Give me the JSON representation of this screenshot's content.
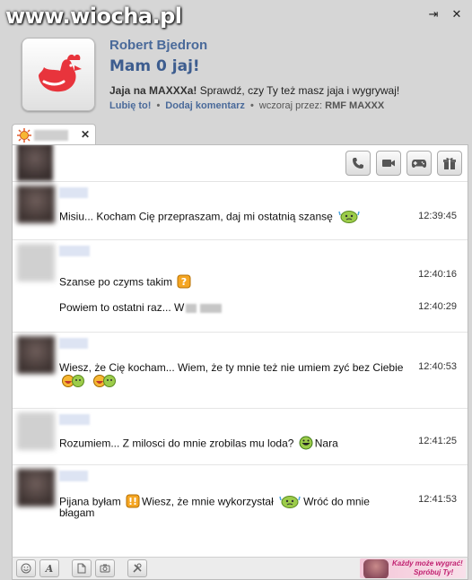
{
  "watermark": "www.wiocha.pl",
  "notification": {
    "name": "Robert Bjedron",
    "title": "Mam 0 jaj!",
    "desc_bold": "Jaja na MAXXXa!",
    "desc_rest": " Sprawdź, czy Ty też masz jaja i wygrywaj!",
    "like": "Lubię to!",
    "comment": "Dodaj komentarz",
    "via_label": "wczoraj przez: ",
    "via_value": "RMF MAXXX"
  },
  "tab": {
    "close": "✕"
  },
  "messages": [
    {
      "avatar": "dark",
      "lines": [
        {
          "parts": [
            "Misiu... Kocham Cię przepraszam, daj mi ostatnią szansę",
            {
              "emoticon": "sad-green"
            }
          ],
          "time": "12:39:45"
        }
      ]
    },
    {
      "avatar": "light",
      "lines": [
        {
          "parts": [
            "Szanse po czyms takim",
            {
              "emoticon": "question"
            }
          ],
          "time": "12:40:16"
        },
        {
          "parts": [
            "Powiem to ostatni raz... W",
            {
              "blur": 1
            },
            {
              "blur": 1
            }
          ],
          "time": "12:40:29"
        }
      ]
    },
    {
      "avatar": "dark",
      "lines": [
        {
          "parts": [
            "Wiesz, że Cię kocham... Wiem, że ty mnie też nie umiem zyć bez Ciebie",
            {
              "emoticon": "laugh-pair"
            },
            {
              "emoticon": "laugh-pair"
            }
          ],
          "time": "12:40:53"
        }
      ]
    },
    {
      "avatar": "light",
      "lines": [
        {
          "parts": [
            "Rozumiem... Z milosci do mnie zrobilas mu loda?",
            {
              "emoticon": "grin"
            },
            "Nara"
          ],
          "time": "12:41:25"
        }
      ]
    },
    {
      "avatar": "dark",
      "lines": [
        {
          "parts": [
            "Pijana byłam",
            {
              "emoticon": "exclaim"
            },
            "Wiesz, że mnie wykorzystał",
            {
              "emoticon": "sad-green"
            },
            "Wróć do mnie"
          ],
          "cont": "błagam",
          "time": "12:41:53"
        }
      ]
    }
  ],
  "ad": {
    "line1": "Każdy może wygrać!",
    "line2": "Spróbuj Ty!"
  },
  "colors": {
    "name": "#4a6a9a",
    "title": "#3d5d8f",
    "rooster": "#e8343c"
  },
  "icons": [
    "minimize-icon",
    "close-icon",
    "rooster-icon",
    "phone-icon",
    "video-icon",
    "gamepad-icon",
    "gift-icon",
    "smiley-icon",
    "font-icon",
    "file-icon",
    "camera-icon",
    "tools-icon"
  ]
}
